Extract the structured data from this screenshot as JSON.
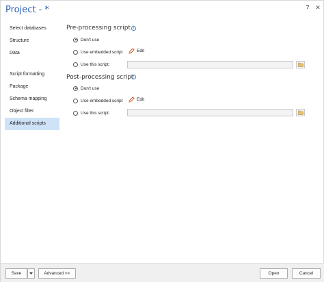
{
  "window": {
    "title": "Project - *",
    "help": "?",
    "close": "✕"
  },
  "sidebar": {
    "items": [
      {
        "label": "Select databases"
      },
      {
        "label": "Structure"
      },
      {
        "label": "Data"
      },
      {
        "label": "Script formatting"
      },
      {
        "label": "Package"
      },
      {
        "label": "Schema mapping"
      },
      {
        "label": "Object filter"
      },
      {
        "label": "Additional scripts",
        "active": true
      }
    ]
  },
  "pre": {
    "title": "Pre-processing script",
    "options": {
      "dont_use": "Don't use",
      "embedded": "Use embedded script",
      "this": "Use this script:"
    },
    "selected": "Don't use",
    "edit_label": "Edit",
    "path_value": ""
  },
  "post": {
    "title": "Post-processing script",
    "options": {
      "dont_use": "Don't use",
      "embedded": "Use embedded script",
      "this": "Use this script:"
    },
    "selected": "Don't use",
    "edit_label": "Edit",
    "path_value": ""
  },
  "footer": {
    "save": "Save",
    "advanced": "Advanced <<",
    "open": "Open",
    "cancel": "Cancel"
  },
  "colors": {
    "accent": "#2b5fb4",
    "active_nav": "#cfe3f8"
  }
}
